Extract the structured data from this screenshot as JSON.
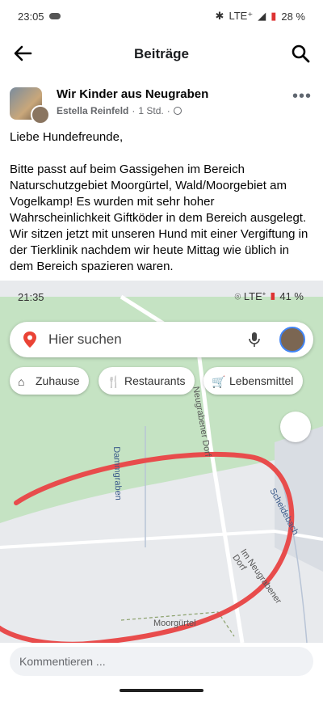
{
  "status_bar": {
    "time": "23:05",
    "network": "LTE⁺",
    "battery": "28 %"
  },
  "header": {
    "title": "Beiträge"
  },
  "post": {
    "group": "Wir Kinder aus Neugraben",
    "author": "Estella Reinfeld",
    "time": "1 Std.",
    "more": "•••",
    "paragraphs": [
      "Liebe Hundefreunde,",
      "Bitte passt auf beim Gassigehen im Bereich Naturschutzgebiet Moorgürtel, Wald/Moorgebiet am Vogelkamp! Es wurden mit sehr hoher Wahrscheinlichkeit Giftköder in dem Bereich ausgelegt. Wir sitzen jetzt mit unseren Hund mit einer Vergiftung in der Tierklinik nachdem wir heute Mittag wie üblich in dem Bereich spazieren waren."
    ]
  },
  "map_screenshot": {
    "status": {
      "time": "21:35",
      "network": "LTE⁺",
      "battery": "41 %"
    },
    "search_placeholder": "Hier suchen",
    "chips": [
      "Zuhause",
      "Restaurants",
      "Lebensmittel"
    ],
    "labels": [
      "Dammgraben",
      "Scheidebach",
      "Im Neugrabener Dorf",
      "Moorgürtel",
      "Neugrabener Dorf"
    ],
    "colors": {
      "green": "#c5e3c3",
      "gray": "#e8eaed",
      "circle": "#e84c4c"
    }
  },
  "comment": {
    "placeholder": "Kommentieren ..."
  }
}
